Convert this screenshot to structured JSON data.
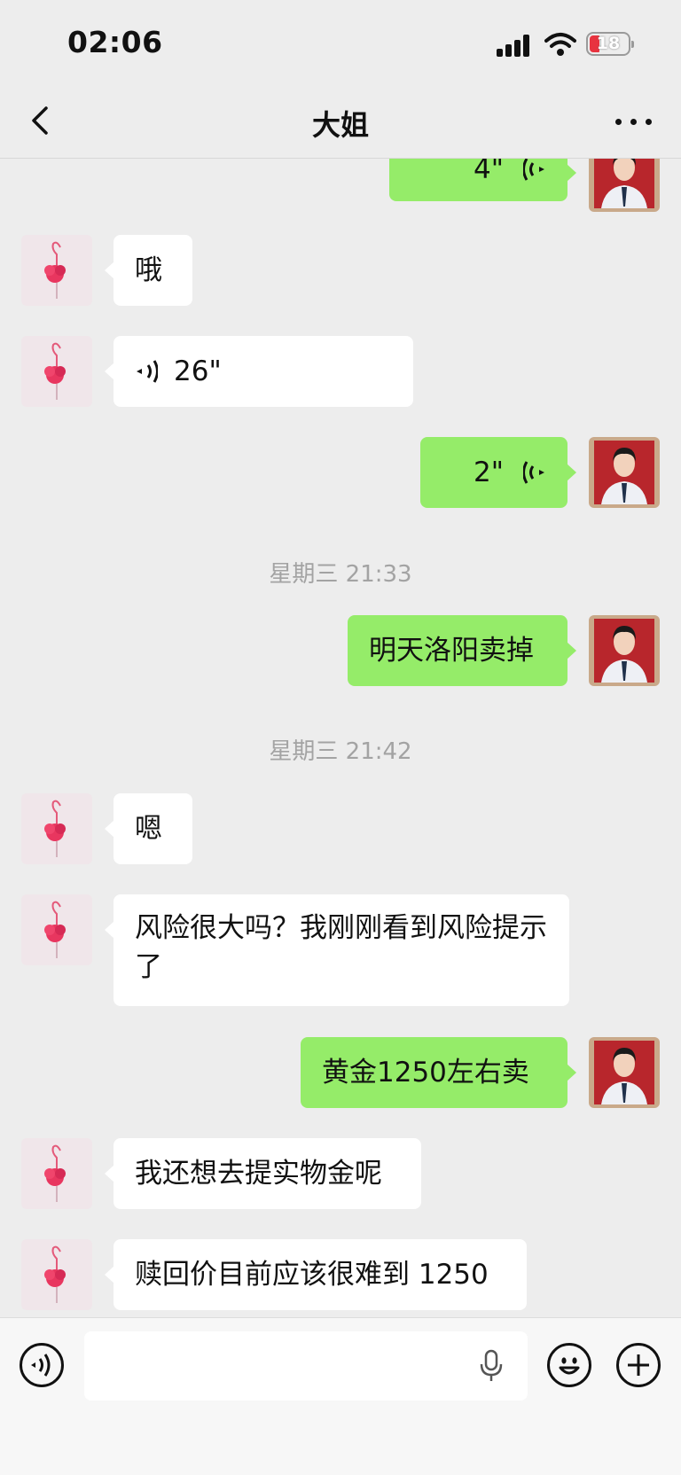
{
  "status_bar": {
    "time": "02:06",
    "battery_level": "18"
  },
  "header": {
    "title": "大姐"
  },
  "messages": [
    {
      "side": "out",
      "type": "voice",
      "duration": "4\""
    },
    {
      "side": "in",
      "type": "text",
      "text": "哦"
    },
    {
      "side": "in",
      "type": "voice",
      "duration": "26\""
    },
    {
      "side": "out",
      "type": "voice",
      "duration": "2\""
    },
    {
      "type": "timestamp",
      "text": "星期三 21:33"
    },
    {
      "side": "out",
      "type": "text",
      "text": "明天洛阳卖掉"
    },
    {
      "type": "timestamp",
      "text": "星期三 21:42"
    },
    {
      "side": "in",
      "type": "text",
      "text": "嗯"
    },
    {
      "side": "in",
      "type": "text",
      "text": "风险很大吗？我刚刚看到风险提示了"
    },
    {
      "side": "out",
      "type": "text",
      "text": "黄金1250左右卖"
    },
    {
      "side": "in",
      "type": "text",
      "text": "我还想去提实物金呢"
    },
    {
      "side": "in",
      "type": "text",
      "text": "赎回价目前应该很难到 1250"
    }
  ],
  "input_bar": {
    "text_value": ""
  },
  "colors": {
    "outgoing_bubble": "#95ec69",
    "incoming_bubble": "#ffffff",
    "background": "#ededed",
    "battery_low": "#e8333f"
  },
  "icons": [
    "back-chevron-icon",
    "more-dots-icon",
    "voice-mode-icon",
    "microphone-icon",
    "emoji-icon",
    "plus-icon",
    "voice-wave-icon"
  ]
}
